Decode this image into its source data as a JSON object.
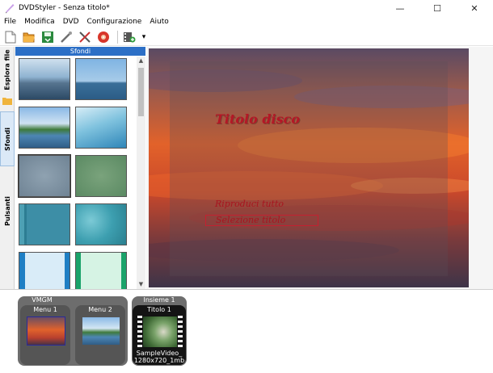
{
  "window": {
    "title": "DVDStyler - Senza titolo*",
    "controls": {
      "minimize": "—",
      "maximize": "☐",
      "close": "✕"
    }
  },
  "menubar": {
    "items": [
      "File",
      "Modifica",
      "DVD",
      "Configurazione",
      "Aiuto"
    ]
  },
  "toolbar": {
    "buttons": [
      {
        "name": "new-icon"
      },
      {
        "name": "open-folder-icon"
      },
      {
        "name": "save-icon"
      },
      {
        "name": "settings-wand-icon"
      },
      {
        "name": "tools-icon"
      },
      {
        "name": "burn-disc-icon"
      },
      {
        "name": "add-file-icon"
      },
      {
        "name": "dropdown-arrow-icon"
      }
    ],
    "dropdown_glyph": "▾"
  },
  "sidetabs": {
    "explorer": "Esplora file",
    "backgrounds": "Sfondi",
    "buttons": "Pulsanti"
  },
  "backgrounds_panel": {
    "header": "Sfondi",
    "scroll_up": "▲",
    "scroll_down": "▼"
  },
  "canvas": {
    "title": "Titolo disco",
    "button_play": "Riproduci tutto",
    "button_select": "Selezione titolo"
  },
  "titleset": {
    "vmgm_label": "VMGM",
    "menus": [
      {
        "label": "Menu 1"
      },
      {
        "label": "Menu 2"
      }
    ],
    "set_label": "Insieme 1",
    "title_label": "Titolo 1",
    "video_name": "SampleVideo_",
    "video_res": "1280x720_1mb"
  }
}
